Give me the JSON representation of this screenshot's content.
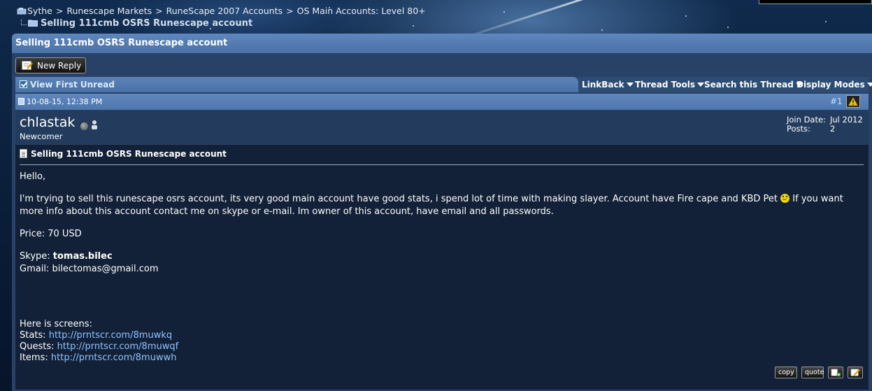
{
  "breadcrumb": {
    "items": [
      "Sythe",
      "Runescape Markets",
      "RuneScape 2007 Accounts",
      "OS Main Accounts: Level 80+"
    ],
    "separator": ">",
    "current": "Selling 111cmb OSRS Runescape account"
  },
  "thread": {
    "title": "Selling 111cmb OSRS Runescape account",
    "new_reply_label": "New Reply",
    "view_first_unread": "View First Unread",
    "tools": [
      "LinkBack",
      "Thread Tools",
      "Search this Thread",
      "Display Modes"
    ]
  },
  "post": {
    "date": "10-08-15, 12:38 PM",
    "number": "#1",
    "username": "chlastak",
    "user_title": "Newcomer",
    "join_date_label": "Join Date:",
    "join_date": "Jul 2012",
    "posts_label": "Posts:",
    "posts_count": "2",
    "title": "Selling 111cmb OSRS Runescape account",
    "greeting": "Hello,",
    "body_part1": "I'm trying to sell this runescape osrs account, its very good main account have good stats, i spend lot of time with making slayer. Account have Fire cape and KBD Pet",
    "body_part2": "If you want more info about this account contact me on skype or e-mail. Im owner of this account, have email and all passwords.",
    "price": "Price: 70 USD",
    "skype_label": "Skype:",
    "skype_value": "tomas.bilec",
    "gmail_label": "Gmail:",
    "gmail_value": "bilectomas@gmail.com",
    "screens_intro": "Here is screens:",
    "stats_label": "Stats:",
    "stats_link": "http://prntscr.com/8muwkq",
    "quests_label": "Quests:",
    "quests_link": "http://prntscr.com/8muwqf",
    "items_label": "Items:",
    "items_link": "http://prntscr.com/8muwwh",
    "buttons": {
      "copy": "copy",
      "quote": "quote"
    },
    "icons": [
      "multiquote-icon",
      "quick-reply-icon"
    ]
  },
  "colors": {
    "title_bar": "#5f87bd",
    "post_body_bg": "#132138",
    "link": "#8fc3ff"
  }
}
